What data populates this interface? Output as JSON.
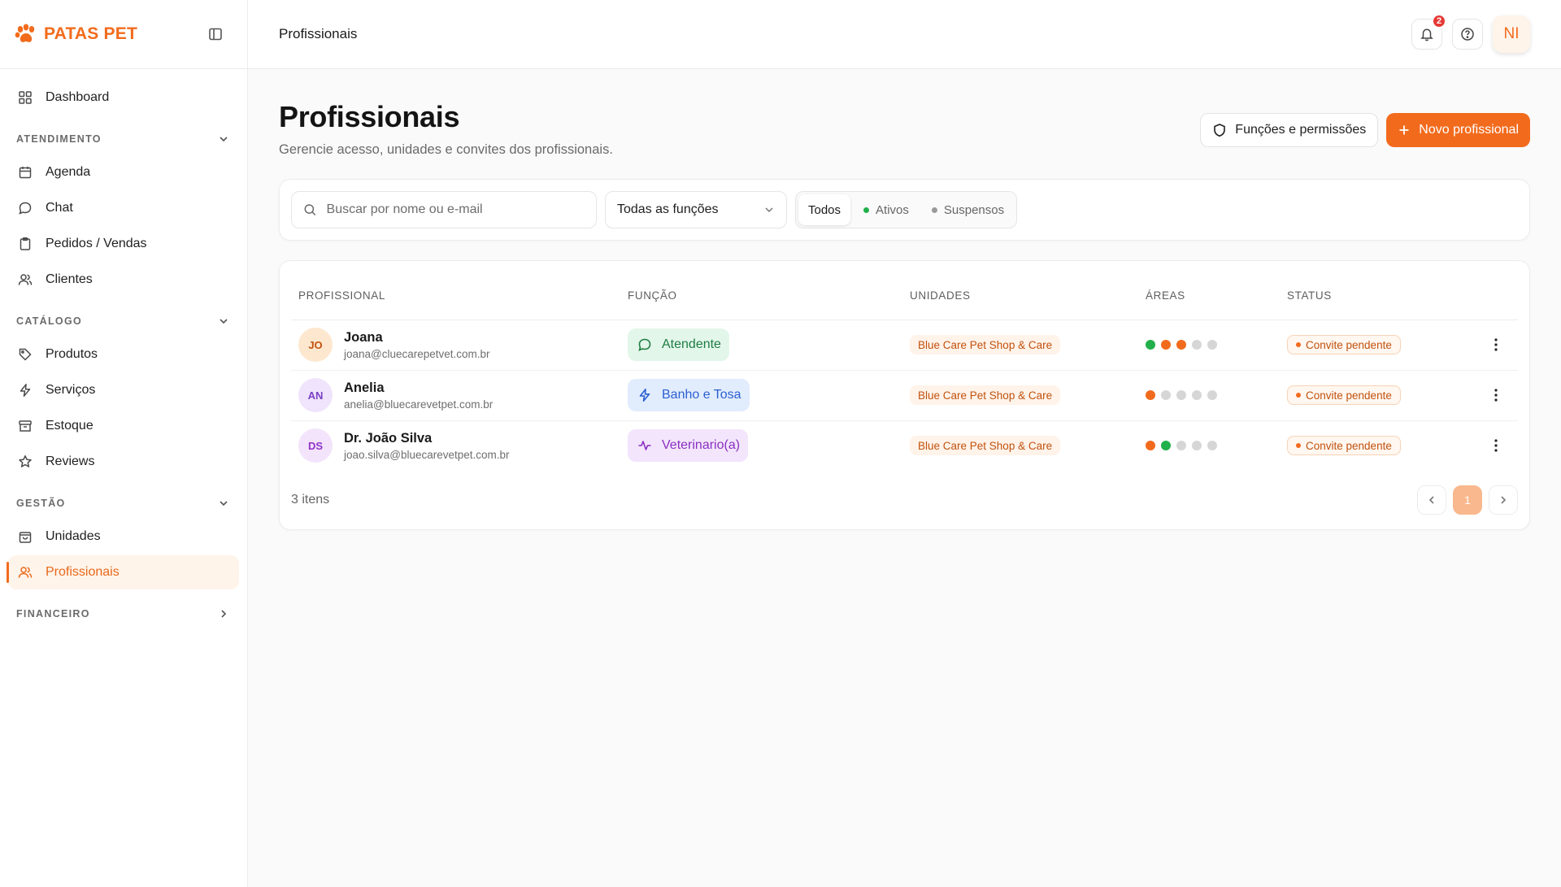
{
  "brand": {
    "name": "PATAS PET"
  },
  "sidebar": {
    "dashboard": "Dashboard",
    "sections": {
      "atendimento": "ATENDIMENTO",
      "catalogo": "CATÁLOGO",
      "gestao": "GESTÃO",
      "financeiro": "FINANCEIRO"
    },
    "items": {
      "agenda": "Agenda",
      "chat": "Chat",
      "pedidos": "Pedidos / Vendas",
      "clientes": "Clientes",
      "produtos": "Produtos",
      "servicos": "Serviços",
      "estoque": "Estoque",
      "reviews": "Reviews",
      "unidades": "Unidades",
      "profissionais": "Profissionais"
    }
  },
  "topbar": {
    "title": "Profissionais",
    "notification_count": "2",
    "user_initials": "NI"
  },
  "page": {
    "title": "Profissionais",
    "subtitle": "Gerencie acesso, unidades e convites dos profissionais.",
    "roles_button": "Funções e permissões",
    "new_button": "Novo profissional"
  },
  "filters": {
    "search_placeholder": "Buscar por nome ou e-mail",
    "role_select": "Todas as funções",
    "status_tabs": [
      "Todos",
      "Ativos",
      "Suspensos"
    ]
  },
  "table": {
    "headers": [
      "PROFISSIONAL",
      "FUNÇÃO",
      "UNIDADES",
      "ÁREAS",
      "STATUS"
    ],
    "rows": [
      {
        "initials": "JO",
        "name": "Joana",
        "email": "joana@cluecarepetvet.com.br",
        "role": "Atendente",
        "unit": "Blue Care Pet Shop & Care",
        "areas": [
          "green",
          "orange",
          "orange",
          "gray",
          "gray"
        ],
        "status": "Convite pendente"
      },
      {
        "initials": "AN",
        "name": "Anelia",
        "email": "anelia@bluecarevetpet.com.br",
        "role": "Banho e Tosa",
        "unit": "Blue Care Pet Shop & Care",
        "areas": [
          "orange",
          "gray",
          "gray",
          "gray",
          "gray"
        ],
        "status": "Convite pendente"
      },
      {
        "initials": "DS",
        "name": "Dr. João Silva",
        "email": "joao.silva@bluecarevetpet.com.br",
        "role": "Veterinario(a)",
        "unit": "Blue Care Pet Shop & Care",
        "areas": [
          "orange",
          "green",
          "gray",
          "gray",
          "gray"
        ],
        "status": "Convite pendente"
      }
    ],
    "count_label": "3 itens",
    "current_page": "1"
  },
  "colors": {
    "accent": "#f26b1d",
    "green": "#22b04b",
    "orange": "#f26b1d",
    "gray": "#d6d6d6"
  }
}
